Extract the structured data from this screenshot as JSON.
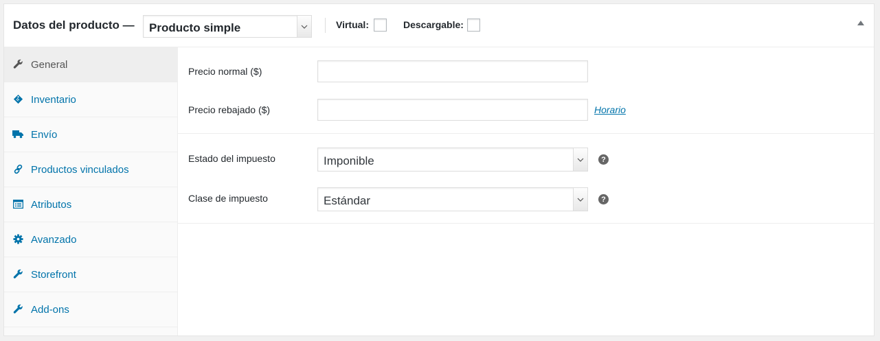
{
  "header": {
    "title": "Datos del producto —",
    "product_type": "Producto simple",
    "virtual_label": "Virtual:",
    "downloadable_label": "Descargable:",
    "virtual_checked": false,
    "downloadable_checked": false
  },
  "tabs": [
    {
      "label": "General",
      "icon": "wrench-icon",
      "active": true
    },
    {
      "label": "Inventario",
      "icon": "tag-icon",
      "active": false
    },
    {
      "label": "Envío",
      "icon": "truck-icon",
      "active": false
    },
    {
      "label": "Productos vinculados",
      "icon": "link-icon",
      "active": false
    },
    {
      "label": "Atributos",
      "icon": "list-view-icon",
      "active": false
    },
    {
      "label": "Avanzado",
      "icon": "gear-icon",
      "active": false
    },
    {
      "label": "Storefront",
      "icon": "wrench-icon",
      "active": false
    },
    {
      "label": "Add-ons",
      "icon": "wrench-icon",
      "active": false
    }
  ],
  "general": {
    "regular_price_label": "Precio normal ($)",
    "regular_price_value": "",
    "sale_price_label": "Precio rebajado ($)",
    "sale_price_value": "",
    "schedule_link": "Horario",
    "tax_status_label": "Estado del impuesto",
    "tax_status_value": "Imponible",
    "tax_class_label": "Clase de impuesto",
    "tax_class_value": "Estándar",
    "help_glyph": "?"
  },
  "colors": {
    "accent": "#0073aa",
    "active_tab_bg": "#eeeeee",
    "sidebar_bg": "#fafafa"
  }
}
